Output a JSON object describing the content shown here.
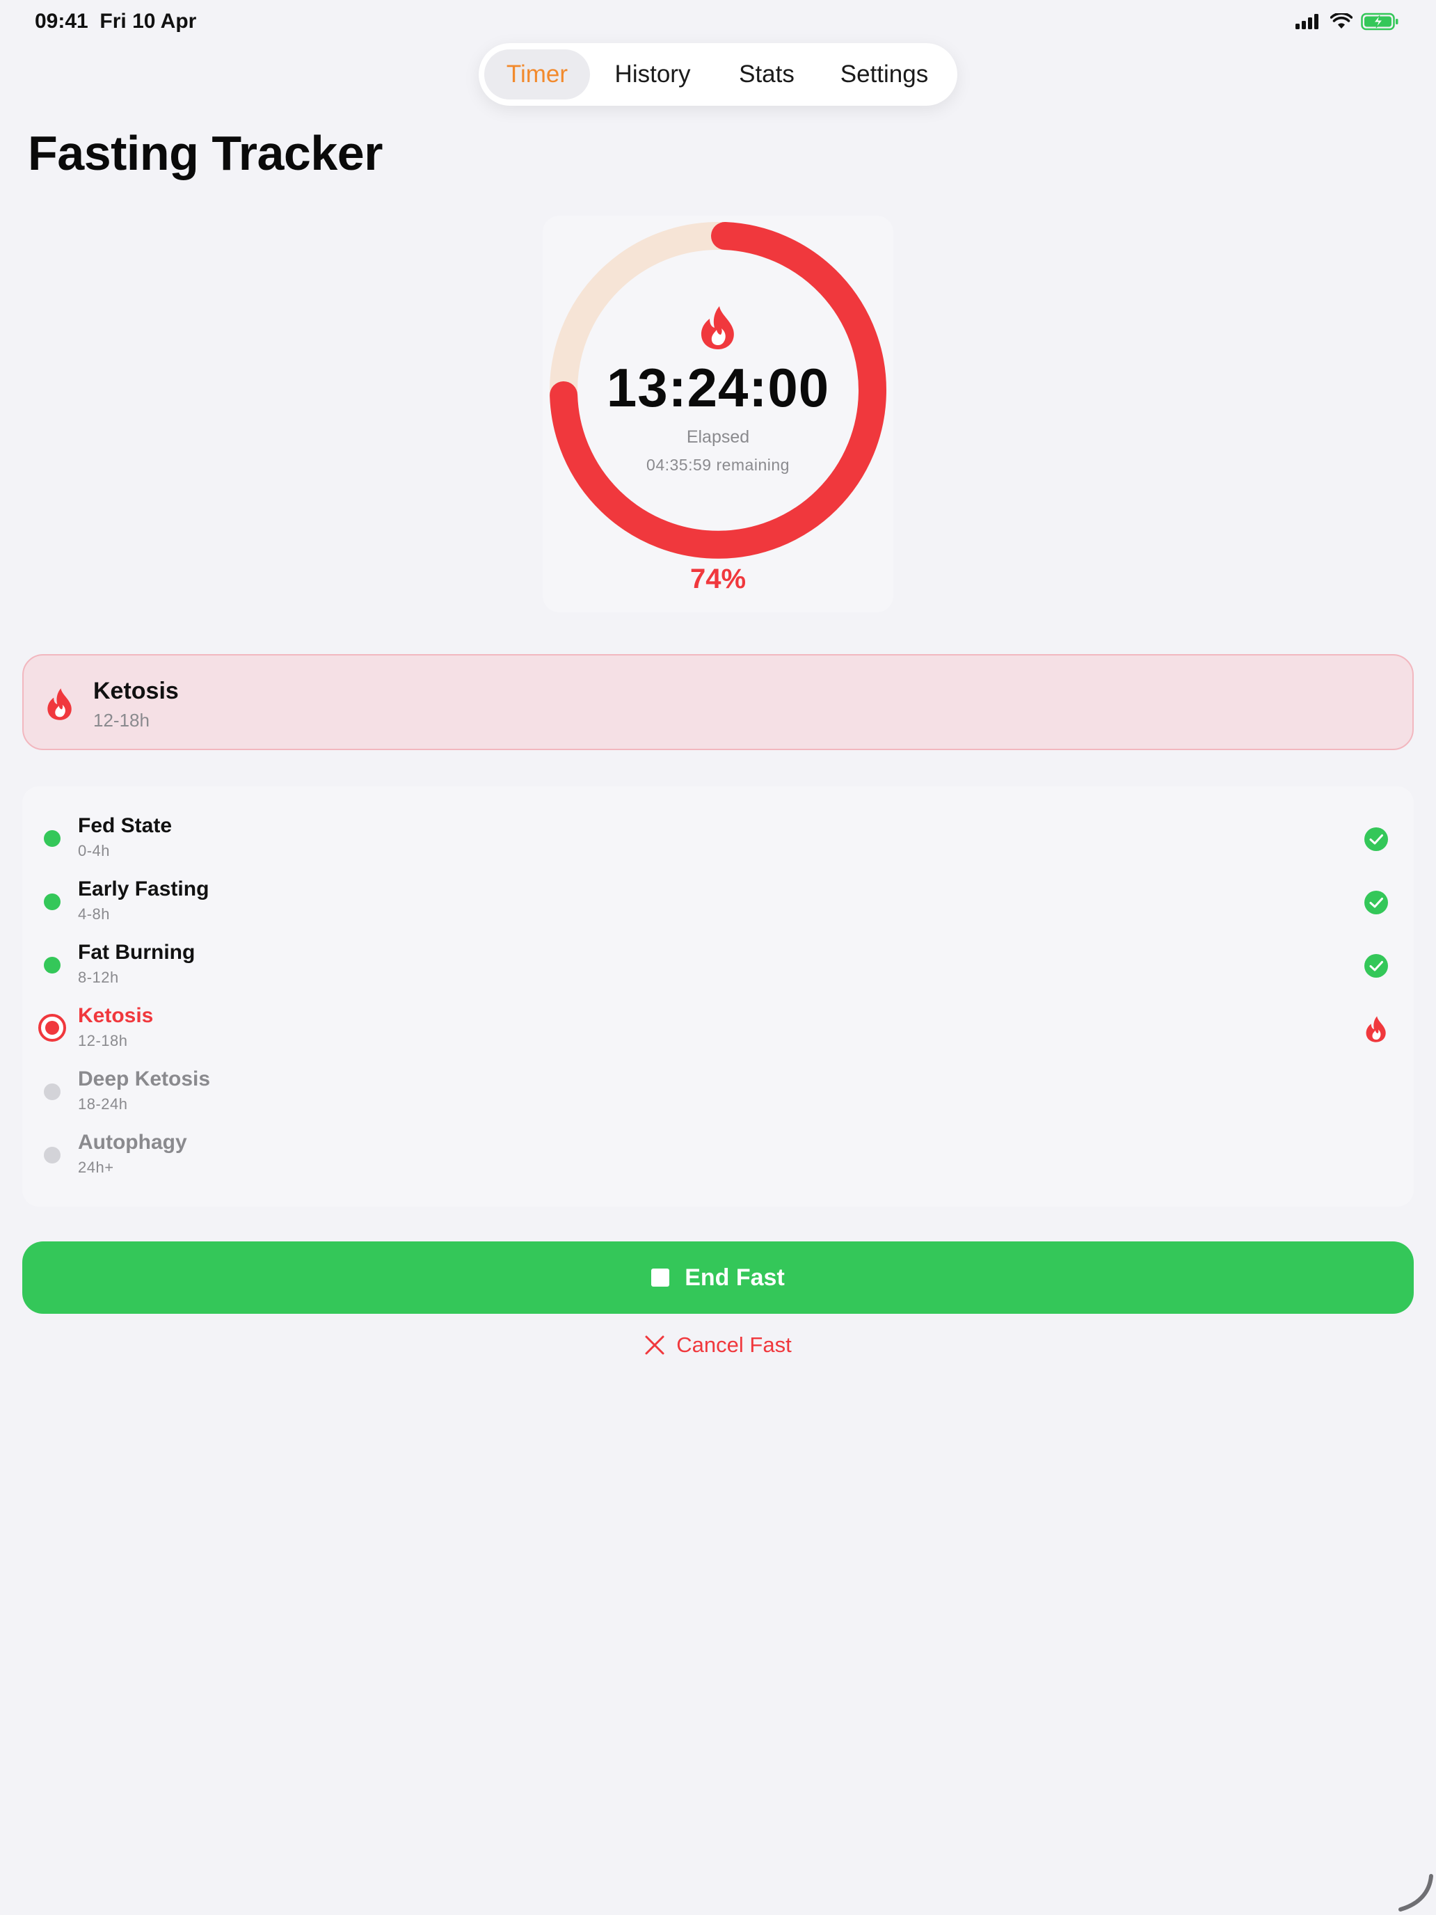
{
  "status_bar": {
    "time": "09:41",
    "date": "Fri 10 Apr",
    "icons": [
      "cellular-signal-icon",
      "wifi-icon",
      "battery-charging-icon"
    ]
  },
  "tabs": [
    {
      "label": "Timer",
      "active": true
    },
    {
      "label": "History",
      "active": false
    },
    {
      "label": "Stats",
      "active": false
    },
    {
      "label": "Settings",
      "active": false
    }
  ],
  "page": {
    "title": "Fasting Tracker"
  },
  "timer": {
    "elapsed": "13:24:00",
    "elapsed_label": "Elapsed",
    "remaining": "04:35:59 remaining",
    "percent_label": "74%",
    "progress": 0.745,
    "icon": "flame-icon"
  },
  "current_phase": {
    "name": "Ketosis",
    "range": "12-18h",
    "icon": "flame-icon"
  },
  "phases": [
    {
      "name": "Fed State",
      "range": "0-4h",
      "status": "done"
    },
    {
      "name": "Early Fasting",
      "range": "4-8h",
      "status": "done"
    },
    {
      "name": "Fat Burning",
      "range": "8-12h",
      "status": "done"
    },
    {
      "name": "Ketosis",
      "range": "12-18h",
      "status": "current"
    },
    {
      "name": "Deep Ketosis",
      "range": "18-24h",
      "status": "future"
    },
    {
      "name": "Autophagy",
      "range": "24h+",
      "status": "future"
    }
  ],
  "actions": {
    "end_label": "End Fast",
    "cancel_label": "Cancel Fast"
  },
  "colors": {
    "accent_orange": "#f28a2d",
    "ring_red": "#f0383d",
    "ring_track": "#f6e4d6",
    "success_green": "#34c759",
    "phase_card_bg": "#f5e0e5",
    "background": "#f3f3f7"
  }
}
